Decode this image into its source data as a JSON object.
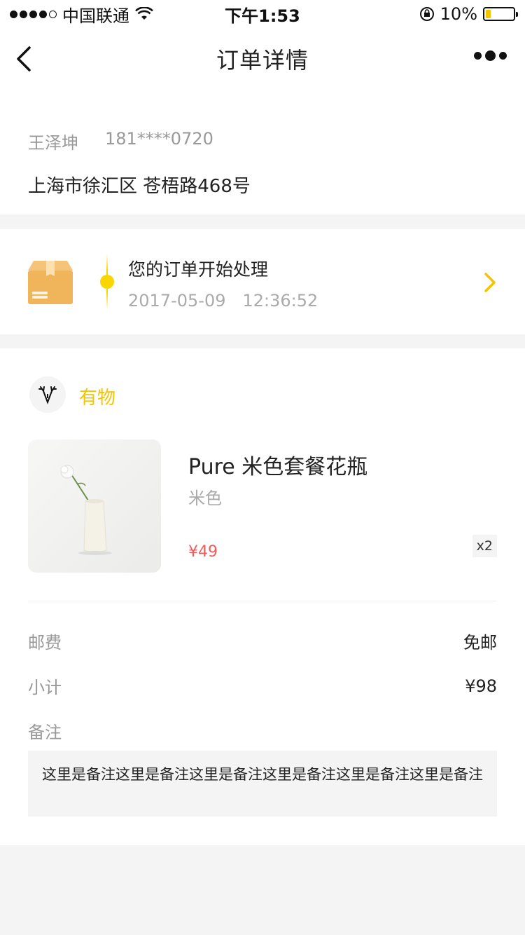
{
  "status_bar": {
    "carrier": "中国联通",
    "time": "下午1:53",
    "battery": "10%",
    "battery_level": 0.1,
    "signal_bars": 4
  },
  "nav": {
    "title": "订单详情"
  },
  "address": {
    "name": "王泽坤",
    "phone": "181****0720",
    "detail": "上海市徐汇区 苍梧路468号"
  },
  "logistics": {
    "status": "您的订单开始处理",
    "date": "2017-05-09",
    "time": "12:36:52"
  },
  "shop": {
    "name": "有物"
  },
  "product": {
    "name": "Pure 米色套餐花瓶",
    "variant": "米色",
    "price": "¥49",
    "quantity": "x2"
  },
  "summary": {
    "shipping_label": "邮费",
    "shipping_value": "免邮",
    "subtotal_label": "小计",
    "subtotal_value": "¥98",
    "remark_label": "备注",
    "remark_text": "这里是备注这里是备注这里是备注这里是备注这里是备注这里是备注"
  },
  "colors": {
    "accent": "#f5c300",
    "price": "#f05b5b",
    "box_icon": "#f0b45a"
  }
}
